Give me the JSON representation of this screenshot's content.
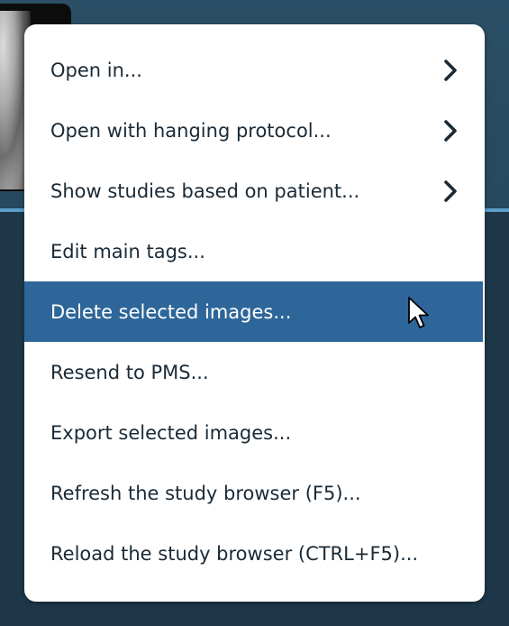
{
  "context_menu": {
    "items": [
      {
        "label": "Open in...",
        "has_submenu": true
      },
      {
        "label": "Open with hanging protocol...",
        "has_submenu": true
      },
      {
        "label": "Show studies based on patient...",
        "has_submenu": true
      },
      {
        "label": "Edit main tags...",
        "has_submenu": false
      },
      {
        "label": "Delete selected images...",
        "has_submenu": false,
        "highlighted": true
      },
      {
        "label": "Resend to PMS...",
        "has_submenu": false
      },
      {
        "label": "Export selected images...",
        "has_submenu": false
      },
      {
        "label": "Refresh the study browser (F5)...",
        "has_submenu": false
      },
      {
        "label": "Reload the study browser (CTRL+F5)...",
        "has_submenu": false
      }
    ]
  },
  "colors": {
    "background": "#1f3a4d",
    "divider_accent": "#5a9ec9",
    "menu_background": "#ffffff",
    "highlight": "#2e6699",
    "text": "#1a2a36",
    "highlight_text": "#ffffff"
  },
  "icons": {
    "submenu": "chevron-right-icon",
    "pointer": "mouse-cursor-icon"
  }
}
